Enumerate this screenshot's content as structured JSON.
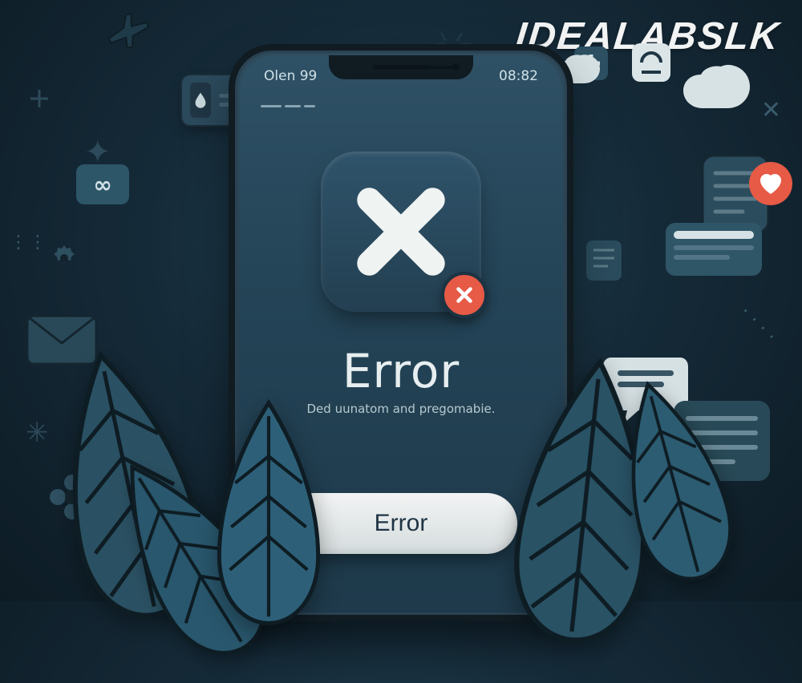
{
  "watermark": "IDEALABSLK",
  "phone": {
    "status_left": "Olen 99",
    "status_right": "08:82",
    "title": "Error",
    "subtitle": "Ded uunatom and pregomabie.",
    "button_label": "Error"
  },
  "icons": {
    "app_x": "x-icon",
    "error_badge": "error-x-icon"
  },
  "colors": {
    "background": "#152a38",
    "accent": "#e65a46",
    "button_bg": "#f2f4f4",
    "text_light": "#e7eef0"
  }
}
